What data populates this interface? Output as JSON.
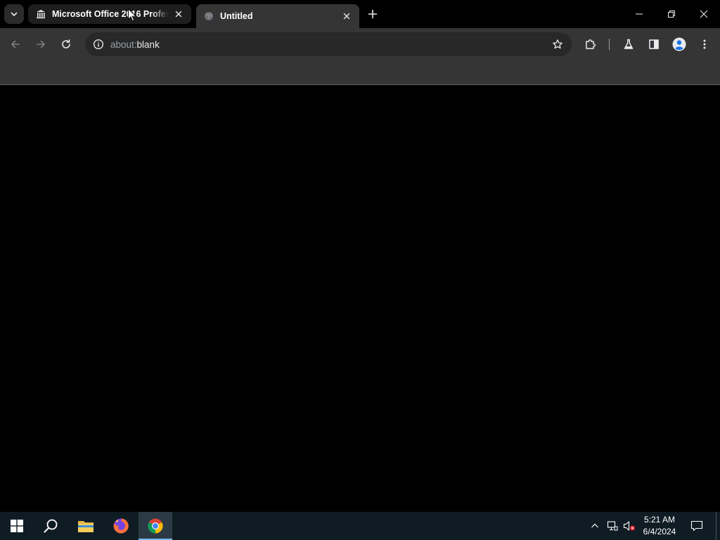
{
  "browser": {
    "tabs": [
      {
        "title": "Microsoft Office 2016 Professional",
        "favicon": "bank-icon",
        "active": false
      },
      {
        "title": "Untitled",
        "favicon": "globe-icon",
        "active": true
      }
    ],
    "address_bar": {
      "url_prefix": "about:",
      "url_host": "blank"
    },
    "accent": "#353535"
  },
  "taskbar": {
    "apps": [
      "start-icon",
      "search-icon",
      "file-explorer-icon",
      "firefox-icon",
      "chrome-icon"
    ],
    "clock": {
      "time": "5:21 AM",
      "date": "6/4/2024"
    },
    "colors": {
      "background": "#101c24",
      "active_indicator": "#76b9ed"
    }
  }
}
